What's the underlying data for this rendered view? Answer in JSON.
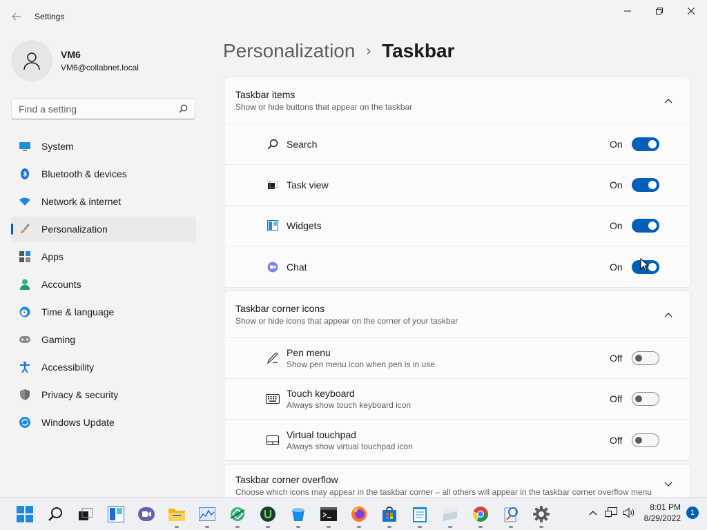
{
  "window": {
    "title": "Settings"
  },
  "profile": {
    "name": "VM6",
    "email": "VM6@collabnet.local"
  },
  "search": {
    "placeholder": "Find a setting"
  },
  "nav": [
    {
      "label": "System",
      "icon": "monitor-icon",
      "active": false
    },
    {
      "label": "Bluetooth & devices",
      "icon": "bluetooth-icon",
      "active": false
    },
    {
      "label": "Network & internet",
      "icon": "wifi-icon",
      "active": false
    },
    {
      "label": "Personalization",
      "icon": "brush-icon",
      "active": true
    },
    {
      "label": "Apps",
      "icon": "apps-icon",
      "active": false
    },
    {
      "label": "Accounts",
      "icon": "person-icon",
      "active": false
    },
    {
      "label": "Time & language",
      "icon": "clock-globe-icon",
      "active": false
    },
    {
      "label": "Gaming",
      "icon": "gamepad-icon",
      "active": false
    },
    {
      "label": "Accessibility",
      "icon": "accessibility-icon",
      "active": false
    },
    {
      "label": "Privacy & security",
      "icon": "shield-icon",
      "active": false
    },
    {
      "label": "Windows Update",
      "icon": "update-icon",
      "active": false
    }
  ],
  "breadcrumb": {
    "parent": "Personalization",
    "separator": "›",
    "current": "Taskbar"
  },
  "sections": {
    "items": {
      "title": "Taskbar items",
      "subtitle": "Show or hide buttons that appear on the taskbar",
      "rows": [
        {
          "title": "Search",
          "state": "On",
          "icon": "search-icon"
        },
        {
          "title": "Task view",
          "state": "On",
          "icon": "task-view-icon"
        },
        {
          "title": "Widgets",
          "state": "On",
          "icon": "widgets-icon"
        },
        {
          "title": "Chat",
          "state": "On",
          "icon": "chat-icon"
        }
      ]
    },
    "corner": {
      "title": "Taskbar corner icons",
      "subtitle": "Show or hide icons that appear on the corner of your taskbar",
      "rows": [
        {
          "title": "Pen menu",
          "subtitle": "Show pen menu icon when pen is in use",
          "state": "Off",
          "icon": "pen-icon"
        },
        {
          "title": "Touch keyboard",
          "subtitle": "Always show touch keyboard icon",
          "state": "Off",
          "icon": "keyboard-icon"
        },
        {
          "title": "Virtual touchpad",
          "subtitle": "Always show virtual touchpad icon",
          "state": "Off",
          "icon": "touchpad-icon"
        }
      ]
    },
    "overflow": {
      "title": "Taskbar corner overflow",
      "subtitle": "Choose which icons may appear in the taskbar corner – all others will appear in the taskbar corner overflow menu"
    }
  },
  "colors": {
    "accent": "#005fb8",
    "background": "#f3f3f3",
    "card": "#fbfbfb"
  },
  "taskbar": {
    "time": "8:01 PM",
    "date": "8/29/2022",
    "notifications": "1"
  }
}
